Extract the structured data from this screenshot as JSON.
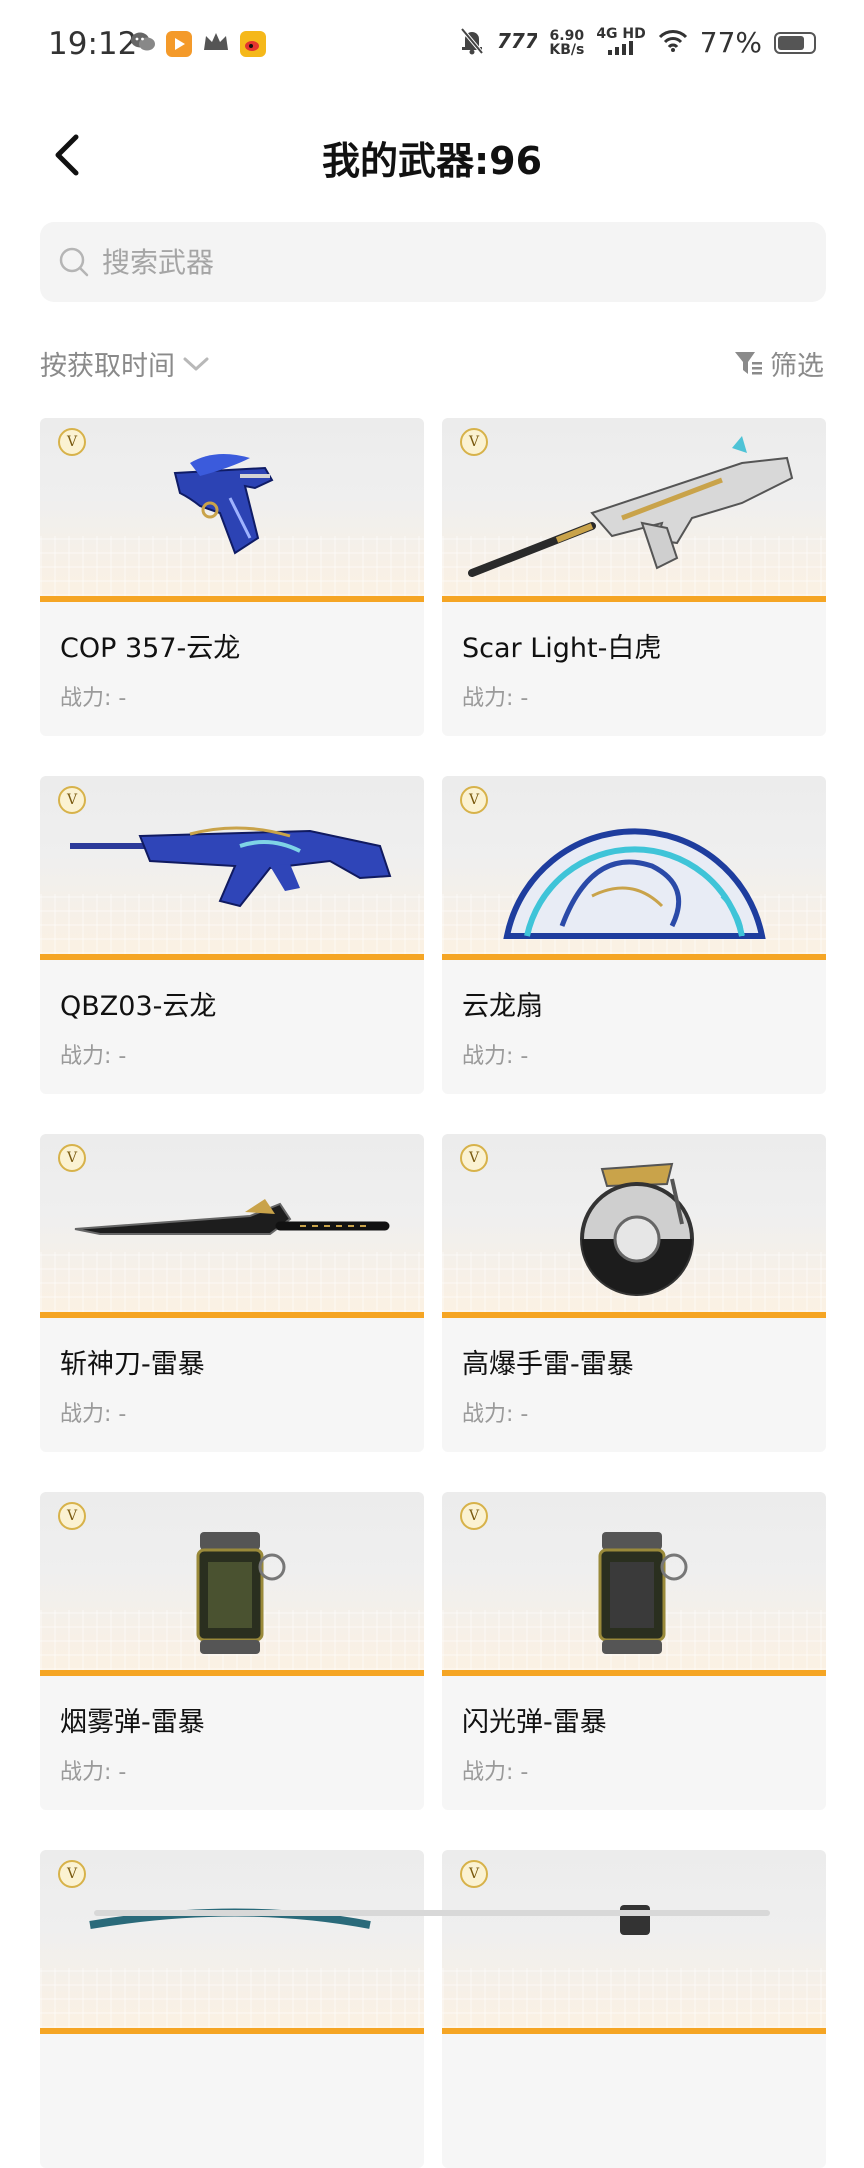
{
  "status_bar": {
    "time": "19:12",
    "net_speed_top": "6.90",
    "net_speed_bottom": "KB/s",
    "network": "4G HD",
    "battery_pct": "77%",
    "battery_level": 0.77
  },
  "header": {
    "title": "我的武器:96"
  },
  "search": {
    "placeholder": "搜索武器",
    "value": ""
  },
  "sort": {
    "label": "按获取时间"
  },
  "filter": {
    "label": "筛选"
  },
  "colors": {
    "accent": "#f5a524",
    "badge": "#d7b24a",
    "card_bg": "#f6f6f6"
  },
  "weapons": [
    {
      "name": "COP 357-云龙",
      "power": "战力: -",
      "badge": "V",
      "icon": "pistol-icon"
    },
    {
      "name": "Scar Light-白虎",
      "power": "战力: -",
      "badge": "V",
      "icon": "rifle-icon"
    },
    {
      "name": "QBZ03-云龙",
      "power": "战力: -",
      "badge": "V",
      "icon": "rifle-icon"
    },
    {
      "name": "云龙扇",
      "power": "战力: -",
      "badge": "V",
      "icon": "fan-icon"
    },
    {
      "name": "斩神刀-雷暴",
      "power": "战力: -",
      "badge": "V",
      "icon": "blade-icon"
    },
    {
      "name": "高爆手雷-雷暴",
      "power": "战力: -",
      "badge": "V",
      "icon": "grenade-icon"
    },
    {
      "name": "烟雾弹-雷暴",
      "power": "战力: -",
      "badge": "V",
      "icon": "smoke-grenade-icon"
    },
    {
      "name": "闪光弹-雷暴",
      "power": "战力: -",
      "badge": "V",
      "icon": "flash-grenade-icon"
    }
  ],
  "partial_badges": [
    "V",
    "V"
  ]
}
